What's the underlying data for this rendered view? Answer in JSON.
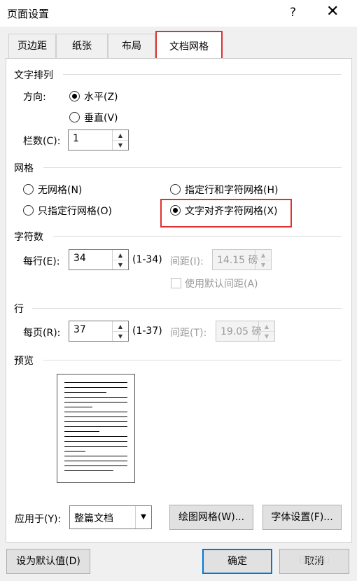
{
  "window": {
    "title": "页面设置",
    "help": "?",
    "close": "✕"
  },
  "tabs": [
    {
      "label": "页边距"
    },
    {
      "label": "纸张"
    },
    {
      "label": "布局"
    },
    {
      "label": "文档网格",
      "active": true
    }
  ],
  "text_direction": {
    "section": "文字排列",
    "direction_label": "方向:",
    "horizontal": "水平(Z)",
    "vertical": "垂直(V)",
    "columns_label": "栏数(C):",
    "columns_value": "1",
    "selected": "horizontal"
  },
  "grid": {
    "section": "网格",
    "options": [
      {
        "label": "无网格(N)"
      },
      {
        "label": "指定行和字符网格(H)"
      },
      {
        "label": "只指定行网格(O)"
      },
      {
        "label": "文字对齐字符网格(X)",
        "selected": true
      }
    ]
  },
  "characters": {
    "section": "字符数",
    "per_line_label": "每行(E):",
    "per_line_value": "34",
    "per_line_range": "(1-34)",
    "pitch_label": "间距(I):",
    "pitch_value": "14.15 磅",
    "default_pitch_label": "使用默认间距(A)"
  },
  "lines": {
    "section": "行",
    "per_page_label": "每页(R):",
    "per_page_value": "37",
    "per_page_range": "(1-37)",
    "pitch_label": "间距(T):",
    "pitch_value": "19.05 磅"
  },
  "preview": {
    "section": "预览"
  },
  "apply": {
    "label": "应用于(Y):",
    "value": "整篇文档",
    "drawing_grid": "绘图网格(W)...",
    "font_settings": "字体设置(F)..."
  },
  "footer": {
    "set_default": "设为默认值(D)",
    "ok": "确定",
    "cancel": "取消",
    "watermark": "Baidu"
  },
  "colors": {
    "highlight": "#e03030",
    "primary_border": "#0078d7"
  }
}
